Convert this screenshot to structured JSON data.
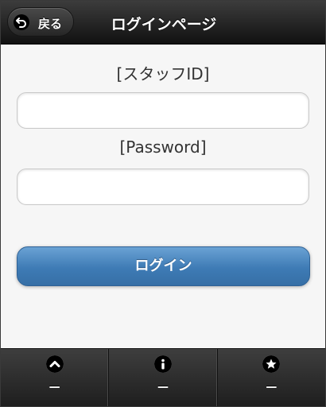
{
  "header": {
    "back_label": "戻る",
    "title": "ログインページ"
  },
  "form": {
    "staff_id_label": "[スタッフID]",
    "staff_id_value": "",
    "password_label": "[Password]",
    "password_value": "",
    "login_label": "ログイン"
  },
  "footer": {
    "items": [
      {
        "icon": "chevron-up-icon",
        "label": "—"
      },
      {
        "icon": "info-icon",
        "label": "—"
      },
      {
        "icon": "star-icon",
        "label": "—"
      }
    ]
  },
  "colors": {
    "header_bg": "#1a1a1a",
    "accent_button": "#3e7bb5",
    "footer_bg": "#2a2a2a"
  }
}
